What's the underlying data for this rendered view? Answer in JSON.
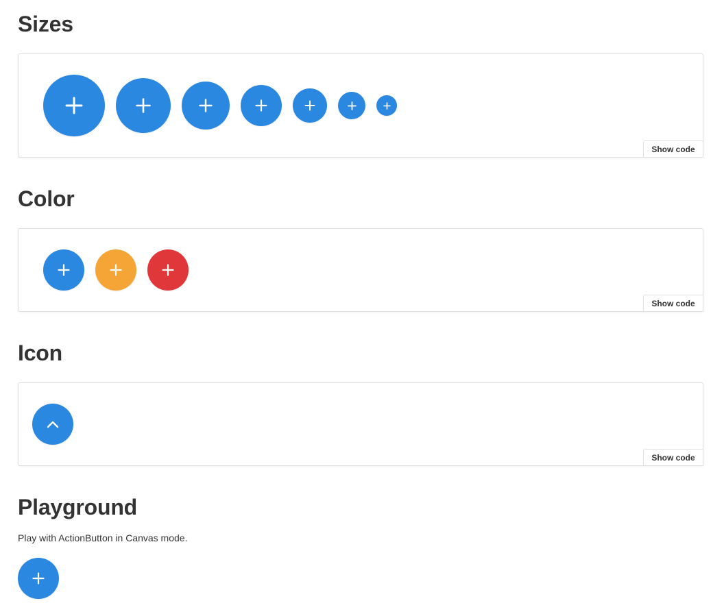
{
  "sections": {
    "sizes": {
      "title": "Sizes",
      "show_code": "Show code"
    },
    "color": {
      "title": "Color",
      "show_code": "Show code"
    },
    "icon": {
      "title": "Icon",
      "show_code": "Show code"
    },
    "playground": {
      "title": "Playground",
      "description": "Play with ActionButton in Canvas mode."
    }
  },
  "buttons": {
    "sizes": [
      {
        "icon": "plus-icon",
        "color": "#2b88e0"
      },
      {
        "icon": "plus-icon",
        "color": "#2b88e0"
      },
      {
        "icon": "plus-icon",
        "color": "#2b88e0"
      },
      {
        "icon": "plus-icon",
        "color": "#2b88e0"
      },
      {
        "icon": "plus-icon",
        "color": "#2b88e0"
      },
      {
        "icon": "plus-icon",
        "color": "#2b88e0"
      },
      {
        "icon": "plus-icon",
        "color": "#2b88e0"
      }
    ],
    "colors": [
      {
        "icon": "plus-icon",
        "color": "#2b88e0"
      },
      {
        "icon": "plus-icon",
        "color": "#f5a535"
      },
      {
        "icon": "plus-icon",
        "color": "#e0383a"
      }
    ],
    "icon_example": {
      "icon": "chevron-up-icon",
      "color": "#2b88e0"
    },
    "playground": {
      "icon": "plus-icon",
      "color": "#2b88e0"
    }
  }
}
